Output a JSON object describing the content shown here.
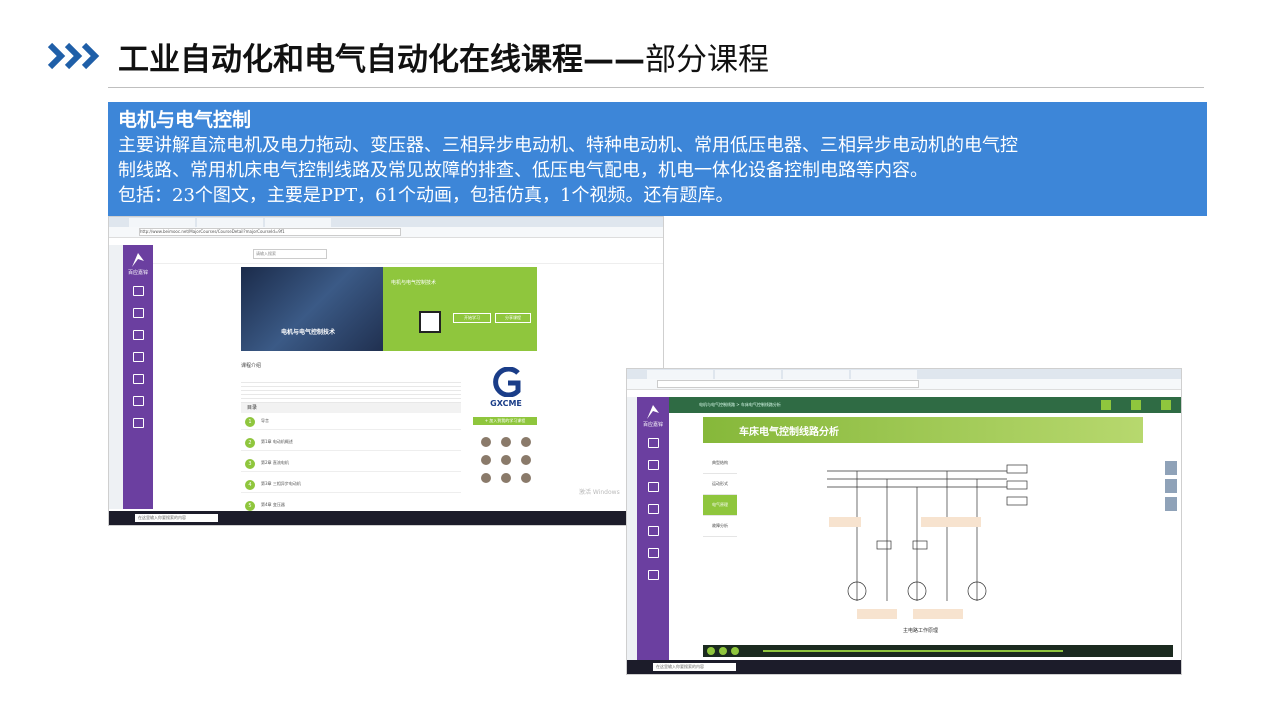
{
  "page": {
    "title_bold": "工业自动化和电气自动化在线课程——",
    "title_light": "部分课程"
  },
  "info": {
    "heading": "电机与电气控制",
    "line1": "主要讲解直流电机及电力拖动、变压器、三相异步电动机、特种电动机、常用低压电器、三相异步电动机的电气控",
    "line2": "制线路、常用机床电气控制线路及常见故障的排查、低压电气配电，机电一体化设备控制电路等内容。",
    "line3": "包括：23个图文，主要是PPT，61个动画，包括仿真，1个视频。还有题库。"
  },
  "colors": {
    "accent": "#3d86d8",
    "chevron": "#1f5fa8",
    "green": "#8fc63d",
    "purple": "#6b3fa0"
  },
  "shot1": {
    "url": "http://www.beimooc.net/MajorCourses/CourseDetail?majorCourseId=9f1",
    "brand": "百应嘉锌",
    "search": "请输入搜索",
    "course_title": "电机与电气控制技术",
    "banner_caption": "电机与电气控制技术",
    "btn_start": "开始学习",
    "btn_share": "分享课程",
    "intro": "课程介绍",
    "list_header": "目录",
    "rows": [
      "导言",
      "第1章 电动机概述",
      "第2章 直流电机",
      "第3章 三相异步电动机",
      "第4章 变压器"
    ],
    "logo": "GXCME",
    "join": "+ 加入到我的学习课程",
    "watermark": "激活 Windows",
    "taskbar_search": "在这里输入你要搜索的内容"
  },
  "shot2": {
    "brand": "百应嘉锌",
    "crumb": "电机与电气控制线路 > 车床电气控制线路分析",
    "heading": "车床电气控制线路分析",
    "menu": [
      "典型结构",
      "运动形式",
      "电气原理",
      "故障分析"
    ],
    "active_menu": 2,
    "caption": "主电路工作原理",
    "taskbar_search": "在这里输入你要搜索的内容"
  }
}
